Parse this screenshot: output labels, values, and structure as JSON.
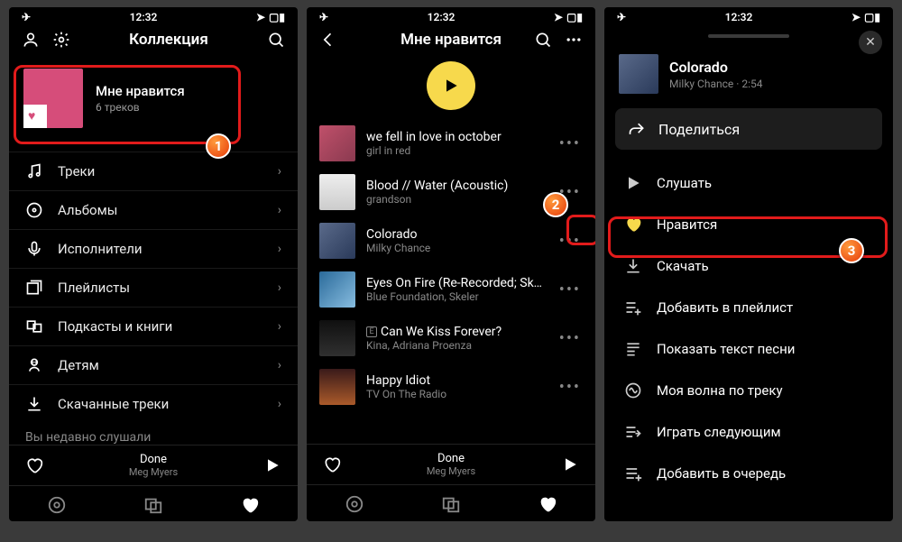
{
  "status": {
    "time": "12:32"
  },
  "phone1": {
    "title": "Коллекция",
    "hero": {
      "title": "Мне нравится",
      "subtitle": "6 треков"
    },
    "menu": [
      {
        "icon": "music-note-icon",
        "label": "Треки"
      },
      {
        "icon": "disc-icon",
        "label": "Альбомы"
      },
      {
        "icon": "mic-icon",
        "label": "Исполнители"
      },
      {
        "icon": "playlist-icon",
        "label": "Плейлисты"
      },
      {
        "icon": "podcast-icon",
        "label": "Подкасты и книги"
      },
      {
        "icon": "child-icon",
        "label": "Детям"
      },
      {
        "icon": "download-icon",
        "label": "Скачанные треки"
      }
    ],
    "cut_label": "Вы недавно слушали",
    "badge": "1"
  },
  "phone2": {
    "title": "Мне нравится",
    "tracks": [
      {
        "title": "we fell in love in october",
        "artist": "girl in red",
        "art": "art1",
        "explicit": false
      },
      {
        "title": "Blood // Water (Acoustic)",
        "artist": "grandson",
        "art": "art2",
        "explicit": false
      },
      {
        "title": "Colorado",
        "artist": "Milky Chance",
        "art": "art3",
        "explicit": false
      },
      {
        "title": "Eyes On Fire (Re-Recorded; Sk…",
        "artist": "Blue Foundation, Skeler",
        "art": "art4",
        "explicit": false
      },
      {
        "title": "Can We Kiss Forever?",
        "artist": "Kina, Adriana Proenza",
        "art": "art5",
        "explicit": true
      },
      {
        "title": "Happy Idiot",
        "artist": "TV On The Radio",
        "art": "art6",
        "explicit": false
      }
    ],
    "badge": "2"
  },
  "now_playing": {
    "title": "Done",
    "artist": "Meg Myers"
  },
  "phone3": {
    "track": {
      "title": "Colorado",
      "meta": "Milky Chance · 2:54"
    },
    "share": "Поделиться",
    "actions": [
      {
        "icon": "play-icon",
        "label": "Слушать",
        "cls": ""
      },
      {
        "icon": "heart-icon",
        "label": "Нравится",
        "cls": "like"
      },
      {
        "icon": "download-icon",
        "label": "Скачать",
        "cls": ""
      },
      {
        "icon": "playlist-add-icon",
        "label": "Добавить в плейлист",
        "cls": ""
      },
      {
        "icon": "lyrics-icon",
        "label": "Показать текст песни",
        "cls": ""
      },
      {
        "icon": "wave-icon",
        "label": "Моя волна по треку",
        "cls": ""
      },
      {
        "icon": "play-next-icon",
        "label": "Играть следующим",
        "cls": ""
      },
      {
        "icon": "queue-icon",
        "label": "Добавить в очередь",
        "cls": ""
      }
    ],
    "badge": "3"
  }
}
